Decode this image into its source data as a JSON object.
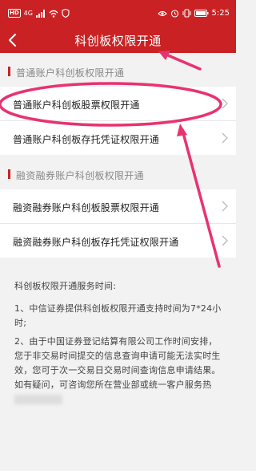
{
  "status_bar": {
    "hd_label": "HD",
    "signal_text": "4G",
    "battery_text": "",
    "time": "5:25"
  },
  "header": {
    "title": "科创板权限开通"
  },
  "sections": [
    {
      "label": "普通账户科创板权限开通",
      "items": [
        {
          "label": "普通账户科创板股票权限开通"
        },
        {
          "label": "普通账户科创板存托凭证权限开通"
        }
      ]
    },
    {
      "label": "融资融券账户科创板权限开通",
      "items": [
        {
          "label": "融资融券账户科创板股票权限开通"
        },
        {
          "label": "融资融券账户科创板存托凭证权限开通"
        }
      ]
    }
  ],
  "notes": {
    "title": "科创板权限开通服务时间:",
    "item1": "1、中信证券提供科创板权限开通支持时间为7*24小时;",
    "item2": "2、由于中国证券登记结算有限公司工作时间安排，您于非交易时间提交的信息查询申请可能无法实时生效，您可于次一交易日交易时间查询信息申请结果。如有疑问，可咨询您所在营业部或统一客户服务热"
  },
  "colors": {
    "brand_red": "#ca2224",
    "annotation_pink": "#e8336e",
    "background": "#f2f2f2"
  },
  "icons": [
    "back-arrow-icon",
    "chevron-right-icon",
    "wifi-icon",
    "signal-icon",
    "battery-icon",
    "alarm-icon",
    "eye-icon",
    "vibrate-icon"
  ]
}
